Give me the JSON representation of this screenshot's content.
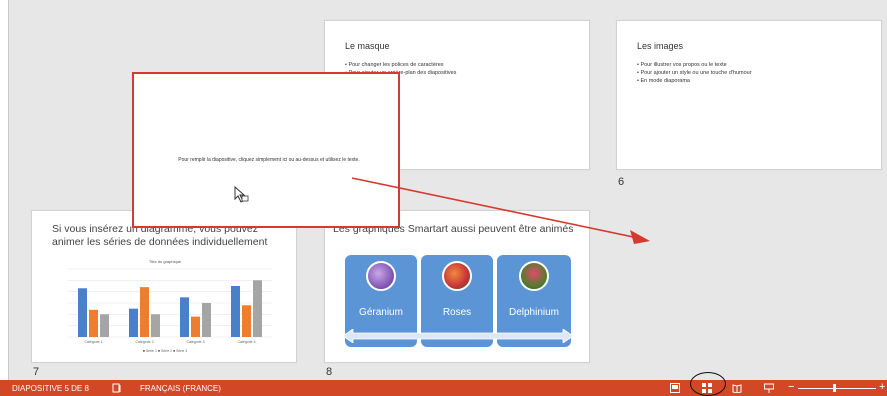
{
  "slides": {
    "masque": {
      "title": "Le masque",
      "bullets": [
        "• Pour changer les polices de caractères",
        "• Pour ajouter un arrière-plan des diapositives"
      ]
    },
    "images": {
      "title": "Les images",
      "bullets": [
        "• Pour illustrer vos propos ou le texte",
        "• Pour ajouter un style ou une touche d'humour",
        "• En mode diaporama"
      ],
      "number": "6"
    },
    "diagram": {
      "title": "Si vous insérez un diagramme, vous pouvez animer les séries de données individuellement",
      "number": "7",
      "chart_title": "Titre du graphique",
      "legend": "■ Série 1  ■ Série 2  ■ Série 3"
    },
    "smartart": {
      "title": "Les graphiques Smartart aussi peuvent être animés",
      "number": "8",
      "items": [
        "Géranium",
        "Roses",
        "Delphinium"
      ]
    },
    "dragged": {
      "placeholder": "Pour remplir la diapositive, cliquez simplement ici ou au-dessus et utilisez le texte."
    }
  },
  "chart_data": {
    "type": "bar",
    "title": "Titre du graphique",
    "categories": [
      "Catégorie 1",
      "Catégorie 2",
      "Catégorie 3",
      "Catégorie 4"
    ],
    "series": [
      {
        "name": "Série 1",
        "values": [
          4.3,
          2.5,
          3.5,
          4.5
        ],
        "color": "#4a7fc9"
      },
      {
        "name": "Série 2",
        "values": [
          2.4,
          4.4,
          1.8,
          2.8
        ],
        "color": "#ed7d31"
      },
      {
        "name": "Série 3",
        "values": [
          2.0,
          2.0,
          3.0,
          5.0
        ],
        "color": "#a5a5a5"
      }
    ],
    "ylim": [
      0,
      6
    ],
    "grid": true
  },
  "statusbar": {
    "slide_info": "DIAPOSITIVE 5 DE 8",
    "language": "FRANÇAIS (FRANCE)"
  },
  "colors": {
    "accent": "#d24726",
    "drag_border": "#d43a2f",
    "smart_blue": "#5b95d6"
  }
}
